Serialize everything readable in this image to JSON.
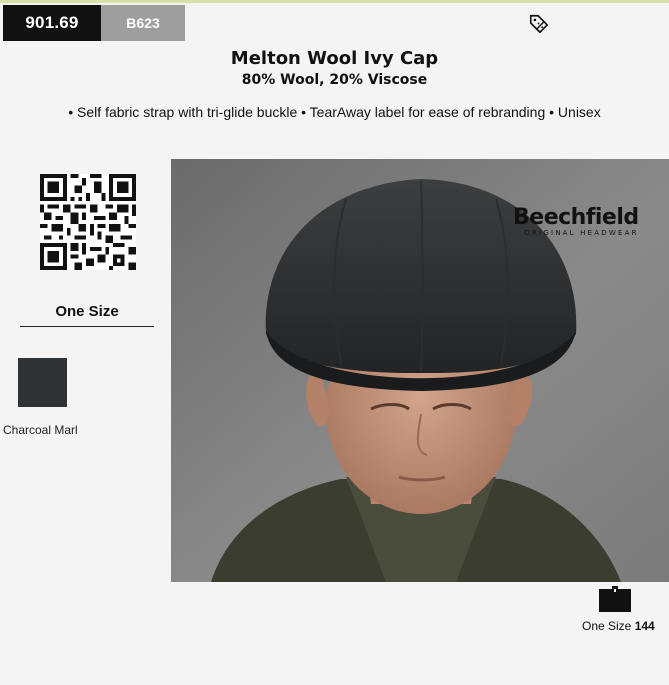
{
  "header": {
    "product_code": "901.69",
    "brand_code": "B623"
  },
  "product": {
    "title": "Melton Wool Ivy Cap",
    "composition": "80% Wool, 20% Viscose",
    "features": "• Self fabric strap with tri-glide buckle • TearAway label for ease of rebranding • Unisex"
  },
  "sizes": {
    "label": "One Size"
  },
  "colours": [
    {
      "name": "Charcoal Marl",
      "hex": "#2f3335"
    }
  ],
  "brand_logo": {
    "name": "Beechfield",
    "tagline": "ORIGINAL HEADWEAR"
  },
  "packaging": {
    "size_label": "One Size",
    "quantity": "144"
  },
  "icons": [
    "discount-tag-icon",
    "qr-code",
    "carton-icon"
  ]
}
